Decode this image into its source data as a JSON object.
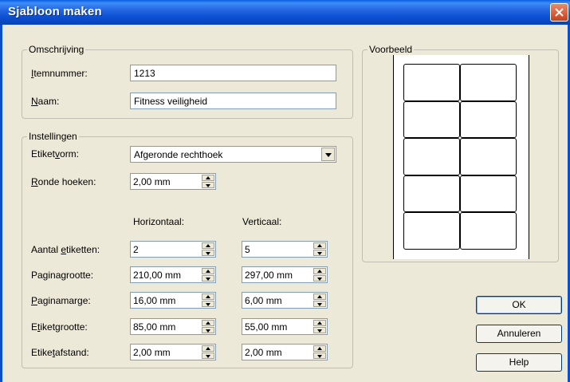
{
  "window": {
    "title": "Sjabloon maken"
  },
  "omschrijving": {
    "legend": "Omschrijving",
    "itemnummer_label": "Itemnummer:",
    "itemnummer_value": "1213",
    "naam_label": "Naam:",
    "naam_value": "Fitness veiligheid"
  },
  "instellingen": {
    "legend": "Instellingen",
    "etiketvorm_label": "Etiketvorm:",
    "etiketvorm_value": "Afgeronde rechthoek",
    "ronde_hoeken_label": "Ronde hoeken:",
    "ronde_hoeken_value": "2,00 mm",
    "col_horizontaal": "Horizontaal:",
    "col_verticaal": "Verticaal:",
    "rows": [
      {
        "label": "Aantal etiketten:",
        "h": "2",
        "v": "5"
      },
      {
        "label": "Paginagrootte:",
        "h": "210,00 mm",
        "v": "297,00 mm"
      },
      {
        "label": "Paginamarge:",
        "h": "16,00 mm",
        "v": "6,00 mm"
      },
      {
        "label": "Etiketgrootte:",
        "h": "85,00 mm",
        "v": "55,00 mm"
      },
      {
        "label": "Etiketafstand:",
        "h": "2,00 mm",
        "v": "2,00 mm"
      }
    ]
  },
  "voorbeeld": {
    "legend": "Voorbeeld",
    "columns": 2,
    "rows": 5
  },
  "buttons": {
    "ok": "OK",
    "annuleren": "Annuleren",
    "help": "Help"
  },
  "colors": {
    "titlebar": "#0a4fd1",
    "dialog_bg": "#ece9d8",
    "close": "#c8401c"
  }
}
